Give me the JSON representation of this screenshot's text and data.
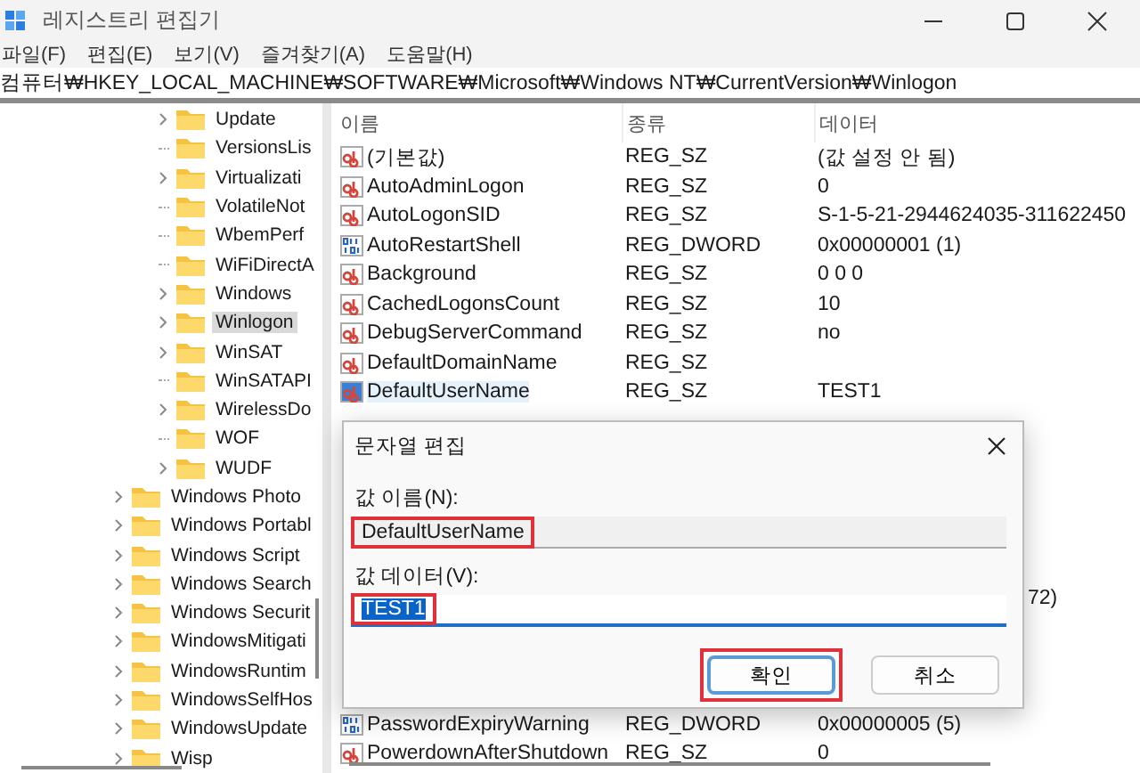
{
  "window": {
    "title": "레지스트리 편집기"
  },
  "menu": [
    "파일(F)",
    "편집(E)",
    "보기(V)",
    "즐겨찾기(A)",
    "도움말(H)"
  ],
  "address": "컴퓨터₩HKEY_LOCAL_MACHINE₩SOFTWARE₩Microsoft₩Windows NT₩CurrentVersion₩Winlogon",
  "tree": {
    "items": [
      {
        "children": [
          {
            "label": "Update",
            "expandable": true,
            "selected": false
          },
          {
            "label": "VersionsLis",
            "expandable": false,
            "selected": false
          },
          {
            "label": "Virtualizati",
            "expandable": true,
            "selected": false
          },
          {
            "label": "VolatileNot",
            "expandable": false,
            "selected": false
          },
          {
            "label": "WbemPerf",
            "expandable": false,
            "selected": false
          },
          {
            "label": "WiFiDirectA",
            "expandable": false,
            "selected": false
          },
          {
            "label": "Windows",
            "expandable": true,
            "selected": false
          },
          {
            "label": "Winlogon",
            "expandable": true,
            "selected": true
          },
          {
            "label": "WinSAT",
            "expandable": true,
            "selected": false
          },
          {
            "label": "WinSATAPI",
            "expandable": false,
            "selected": false
          },
          {
            "label": "WirelessDo",
            "expandable": true,
            "selected": false
          },
          {
            "label": "WOF",
            "expandable": false,
            "selected": false
          },
          {
            "label": "WUDF",
            "expandable": true,
            "selected": false
          }
        ]
      },
      {
        "label": "Windows Photo",
        "expandable": true,
        "selected": false
      },
      {
        "label": "Windows Portabl",
        "expandable": true,
        "selected": false
      },
      {
        "label": "Windows Script",
        "expandable": true,
        "selected": false
      },
      {
        "label": "Windows Search",
        "expandable": true,
        "selected": false
      },
      {
        "label": "Windows Securit",
        "expandable": true,
        "selected": false
      },
      {
        "label": "WindowsMitigati",
        "expandable": true,
        "selected": false
      },
      {
        "label": "WindowsRuntim",
        "expandable": true,
        "selected": false
      },
      {
        "label": "WindowsSelfHos",
        "expandable": true,
        "selected": false
      },
      {
        "label": "WindowsUpdate",
        "expandable": true,
        "selected": false
      },
      {
        "label": "Wisp",
        "expandable": true,
        "selected": false
      }
    ]
  },
  "values": {
    "columns": [
      "이름",
      "종류",
      "데이터"
    ],
    "rows_above": [
      {
        "kind": "string",
        "name": "(기본값)",
        "type": "REG_SZ",
        "data": "(값 설정 안 됨)",
        "selected": false
      },
      {
        "kind": "string",
        "name": "AutoAdminLogon",
        "type": "REG_SZ",
        "data": "0",
        "selected": false
      },
      {
        "kind": "string",
        "name": "AutoLogonSID",
        "type": "REG_SZ",
        "data": "S-1-5-21-2944624035-311622450",
        "selected": false
      },
      {
        "kind": "dword",
        "name": "AutoRestartShell",
        "type": "REG_DWORD",
        "data": "0x00000001 (1)",
        "selected": false
      },
      {
        "kind": "string",
        "name": "Background",
        "type": "REG_SZ",
        "data": "0 0 0",
        "selected": false
      },
      {
        "kind": "string",
        "name": "CachedLogonsCount",
        "type": "REG_SZ",
        "data": "10",
        "selected": false
      },
      {
        "kind": "string",
        "name": "DebugServerCommand",
        "type": "REG_SZ",
        "data": "no",
        "selected": false
      },
      {
        "kind": "string",
        "name": "DefaultDomainName",
        "type": "REG_SZ",
        "selected": false
      },
      {
        "kind": "string",
        "name": "DefaultUserName",
        "type": "REG_SZ",
        "data": "TEST1",
        "selected": true
      }
    ],
    "partial_row": {
      "data": "72)"
    },
    "rows_below": [
      {
        "kind": "dword",
        "name": "PasswordExpiryWarning",
        "type": "REG_DWORD",
        "data": "0x00000005 (5)",
        "selected": false
      },
      {
        "kind": "string",
        "name": "PowerdownAfterShutdown",
        "type": "REG_SZ",
        "data": "0",
        "selected": false
      }
    ]
  },
  "dialog": {
    "title": "문자열 편집",
    "name_label": "값 이름(N):",
    "name_value": "DefaultUserName",
    "name_annotated": true,
    "data_label": "값 데이터(V):",
    "data_value": "TEST1",
    "data_annotated": true,
    "buttons": [
      {
        "label": "확인",
        "primary": true,
        "annotated": true
      },
      {
        "label": "취소",
        "primary": false,
        "annotated": false
      }
    ]
  }
}
